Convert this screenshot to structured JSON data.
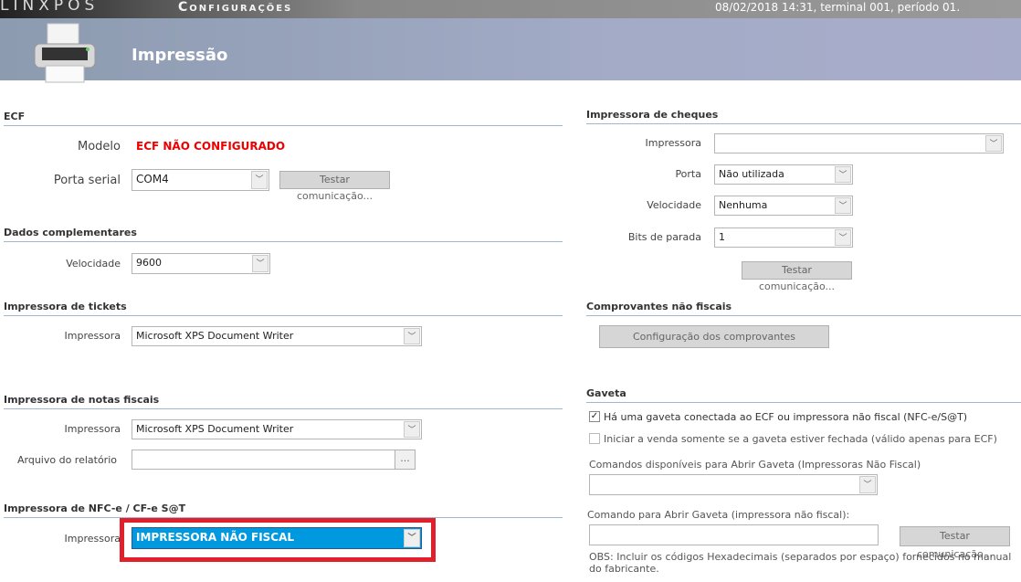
{
  "topbar": {
    "brand": "LINXPOS",
    "title": "Configurações",
    "status": "08/02/2018 14:31, terminal 001, período 01."
  },
  "header": {
    "title": "Impressão",
    "icon": "printer-icon"
  },
  "ecf": {
    "heading": "ECF",
    "modelo_label": "Modelo",
    "modelo_value": "ECF NÃO CONFIGURADO",
    "porta_label": "Porta serial",
    "porta_value": "COM4",
    "test_button": "Testar comunicação..."
  },
  "dados": {
    "heading": "Dados complementares",
    "velocidade_label": "Velocidade",
    "velocidade_value": "9600"
  },
  "tickets": {
    "heading": "Impressora de tickets",
    "impressora_label": "Impressora",
    "impressora_value": "Microsoft XPS Document Writer"
  },
  "notas": {
    "heading": "Impressora de notas fiscais",
    "impressora_label": "Impressora",
    "impressora_value": "Microsoft XPS Document Writer",
    "arquivo_label": "Arquivo do relatório",
    "arquivo_value": "",
    "browse": "..."
  },
  "nfce": {
    "heading": "Impressora de NFC-e / CF-e S@T",
    "impressora_label": "Impressora",
    "impressora_value": "IMPRESSORA NÃO FISCAL",
    "highlight_color": "#e0202a",
    "selected_color": "#0099e0"
  },
  "cheques": {
    "heading": "Impressora de cheques",
    "impressora_label": "Impressora",
    "impressora_value": "",
    "porta_label": "Porta",
    "porta_value": "Não utilizada",
    "velocidade_label": "Velocidade",
    "velocidade_value": "Nenhuma",
    "bits_label": "Bits de parada",
    "bits_value": "1",
    "test_button": "Testar comunicação..."
  },
  "comprovantes": {
    "heading": "Comprovantes não fiscais",
    "button": "Configuração dos comprovantes"
  },
  "gaveta": {
    "heading": "Gaveta",
    "check1_label": "Há uma gaveta conectada ao ECF ou impressora não fiscal (NFC-e/S@T)",
    "check1_checked": true,
    "check2_label": "Iniciar a venda somente se a gaveta estiver fechada (válido apenas para ECF)",
    "check2_checked": false,
    "comandos_label": "Comandos disponíveis para Abrir Gaveta (Impressoras Não Fiscal)",
    "comandos_value": "",
    "comando_label": "Comando para Abrir Gaveta (impressora não fiscal):",
    "comando_value": "",
    "test_button": "Testar comunicação...",
    "obs": "OBS: Incluir os códigos Hexadecimais (separados por espaço) fornecidos no manual do fabricante."
  }
}
